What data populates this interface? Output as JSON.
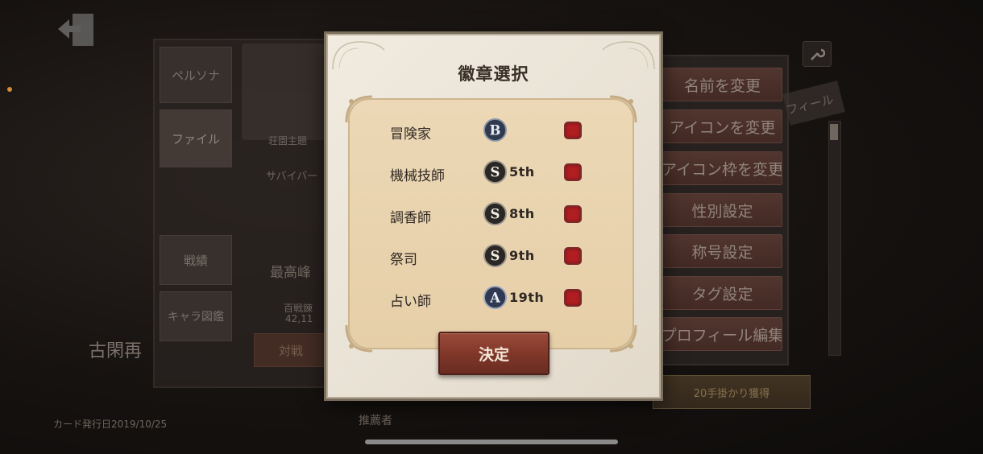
{
  "background": {
    "left_tabs": [
      {
        "label": "ペルソナ"
      },
      {
        "label": "ファイル"
      },
      {
        "label": "戦績"
      },
      {
        "label": "キャラ図鑑"
      }
    ],
    "card_label": "荘園主題",
    "survivor_label": "サバイバー",
    "rank_title": "最高峰",
    "rank_sub": "百戦錬",
    "rank_number": "42,11",
    "versus_label": "対戦",
    "player_name": "古閑再",
    "bottom_text": "カード発行日2019/10/25",
    "bottom_right_text": "推薦者",
    "right_menu": [
      {
        "label": "名前を変更"
      },
      {
        "label": "アイコンを変更"
      },
      {
        "label": "アイコン枠を変更"
      },
      {
        "label": "性別設定"
      },
      {
        "label": "称号設定"
      },
      {
        "label": "タグ設定"
      },
      {
        "label": "プロフィール編集"
      }
    ],
    "profile_tag": "フィール",
    "reward_label": "20手掛かり獲得"
  },
  "modal": {
    "title": "徽章選択",
    "rows": [
      {
        "name": "冒険家",
        "badge": "B",
        "badge_icon": "b-badge-icon",
        "rank": ""
      },
      {
        "name": "機械技師",
        "badge": "S",
        "badge_icon": "s-badge-icon",
        "rank": "5th"
      },
      {
        "name": "調香師",
        "badge": "S",
        "badge_icon": "s-badge-icon",
        "rank": "8th"
      },
      {
        "name": "祭司",
        "badge": "S",
        "badge_icon": "s-badge-icon",
        "rank": "9th"
      },
      {
        "name": "占い師",
        "badge": "A",
        "badge_icon": "a-badge-icon",
        "rank": "19th"
      }
    ],
    "confirm_label": "決定"
  },
  "colors": {
    "checkbox_red": "#b01e22",
    "confirm_button": "#7e3628",
    "panel_parchment": "#e6cfa8",
    "modal_bg": "#e8e1d4"
  }
}
